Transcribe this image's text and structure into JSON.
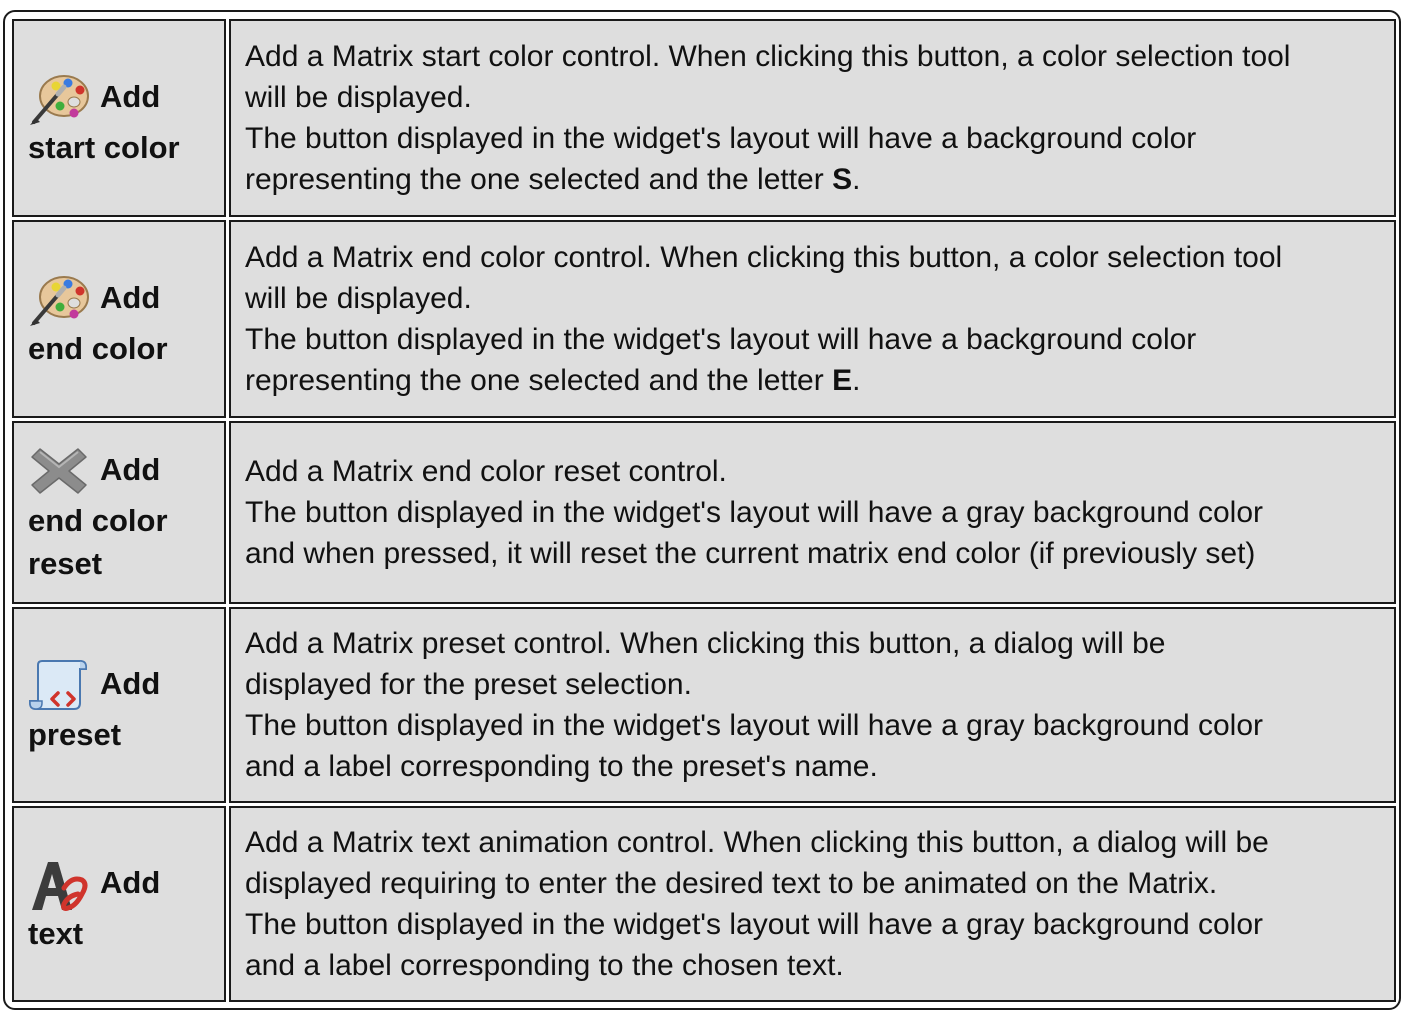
{
  "rows": [
    {
      "icon": "palette-icon",
      "name_first": "Add",
      "name_rest": [
        "start color"
      ],
      "desc": [
        "Add a Matrix start color control. When clicking this button, a color selection tool",
        "will be displayed.",
        "The button displayed in the widget's layout will have a background color"
      ],
      "desc_last_prefix": "representing the one selected and the letter ",
      "desc_last_bold": "S",
      "desc_last_suffix": "."
    },
    {
      "icon": "palette-icon",
      "name_first": "Add",
      "name_rest": [
        "end color"
      ],
      "desc": [
        "Add a Matrix end color control. When clicking this button, a color selection tool",
        "will be displayed.",
        "The button displayed in the widget's layout will have a background color"
      ],
      "desc_last_prefix": "representing the one selected and the letter ",
      "desc_last_bold": "E",
      "desc_last_suffix": "."
    },
    {
      "icon": "close-x-icon",
      "name_first": "Add",
      "name_rest": [
        "end color",
        "reset"
      ],
      "desc": [
        "Add a Matrix end color reset control.",
        "The button displayed in the widget's layout will have a gray background color",
        "and when pressed, it will reset the current matrix end color (if previously set)"
      ]
    },
    {
      "icon": "scroll-icon",
      "name_first": "Add",
      "name_rest": [
        "preset"
      ],
      "desc": [
        "Add a Matrix preset control. When clicking this button, a dialog will be",
        "displayed for the preset selection.",
        "The button displayed in the widget's layout will have a gray background color",
        "and a label corresponding to the preset's name."
      ]
    },
    {
      "icon": "text-font-icon",
      "name_first": "Add",
      "name_rest": [
        "text"
      ],
      "desc": [
        "Add a Matrix text animation control. When clicking this button, a dialog will be",
        "displayed requiring to enter the desired text to be animated on the Matrix.",
        "The button displayed in the widget's layout will have a gray background color",
        "and a label corresponding to the chosen text."
      ]
    }
  ]
}
